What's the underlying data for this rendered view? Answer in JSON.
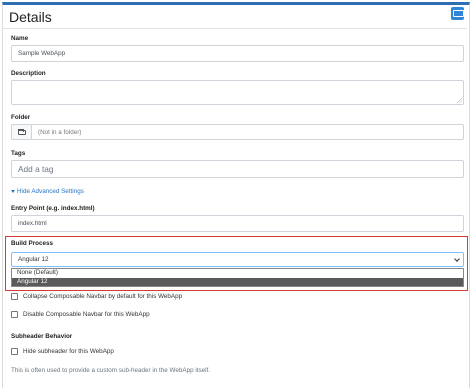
{
  "header": {
    "title": "Details",
    "icon": "monitor-icon"
  },
  "name": {
    "label": "Name",
    "value": "Sample WebApp"
  },
  "description": {
    "label": "Description",
    "value": ""
  },
  "folder": {
    "label": "Folder",
    "placeholder": "(Not in a folder)",
    "icon": "folder-icon"
  },
  "tags": {
    "label": "Tags",
    "placeholder": "Add a tag"
  },
  "advanced_link": "Hide Advanced Settings",
  "entry_point": {
    "label": "Entry Point (e.g. index.html)",
    "value": "index.html"
  },
  "build_process": {
    "label": "Build Process",
    "selected": "Angular 12",
    "options": [
      "None (Default)",
      "Angular 12"
    ],
    "highlighted_option": "Angular 12"
  },
  "checkboxes": {
    "collapse_navbar": "Collapse Composable Navbar by default for this WebApp",
    "disable_navbar": "Disable Composable Navbar for this WebApp"
  },
  "subheader": {
    "label": "Subheader Behavior",
    "checkbox": "Hide subheader for this WebApp",
    "help": "This is often used to provide a custom sub-header in the WebApp itself."
  },
  "colors": {
    "accent": "#2f6db3",
    "highlight_border": "#d43a3a",
    "link": "#2a73c4"
  }
}
